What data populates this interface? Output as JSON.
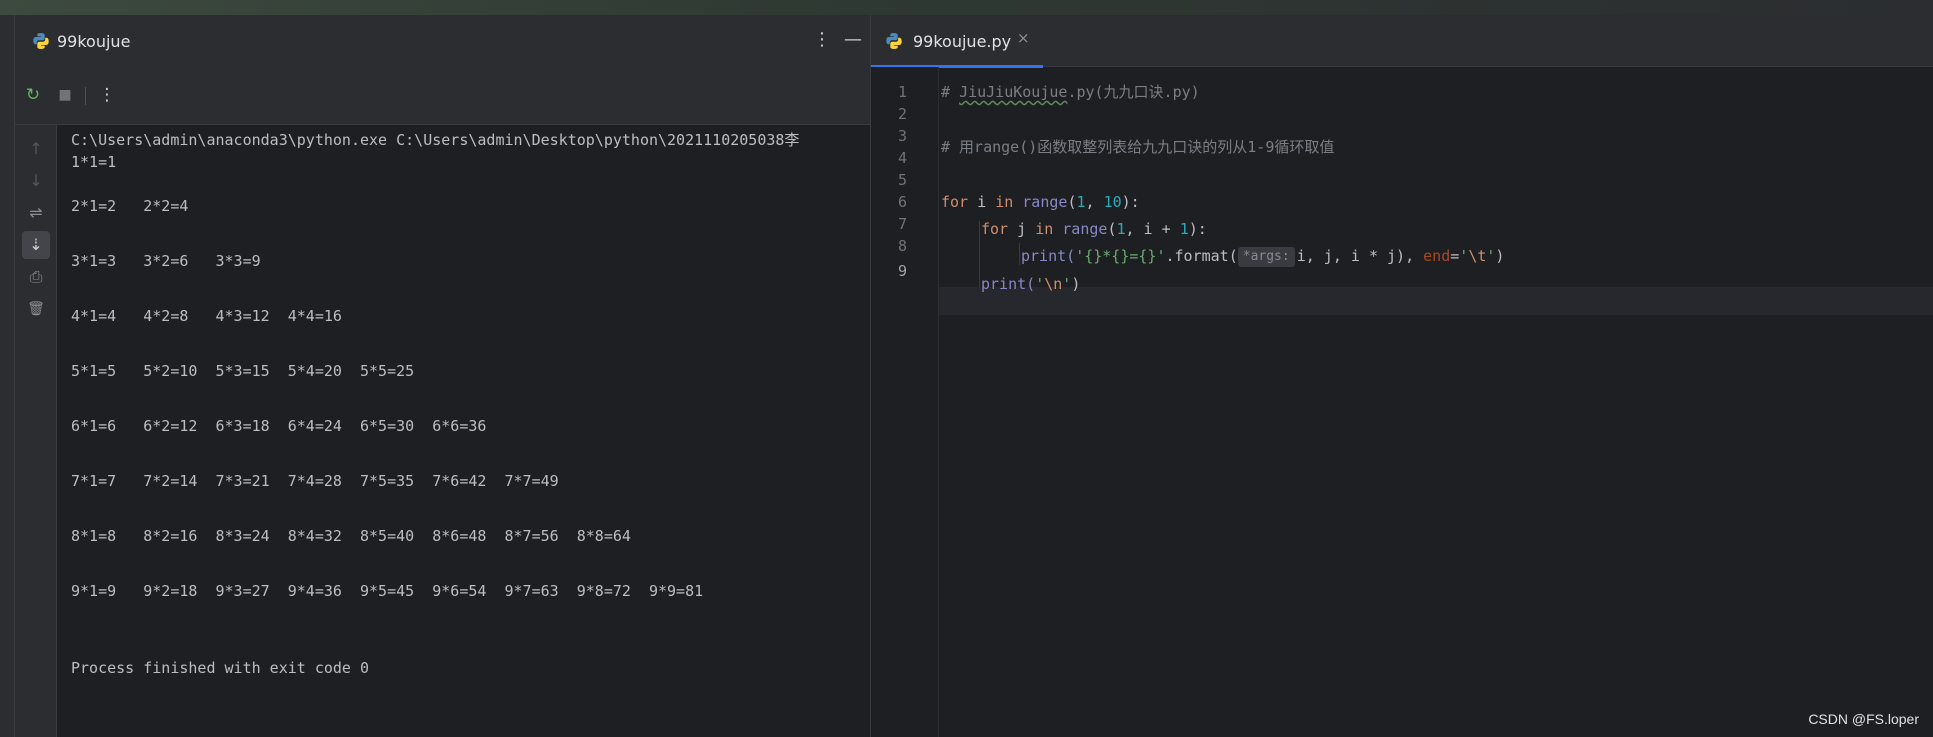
{
  "run_panel": {
    "title": "99koujue",
    "more_icon": "⋮",
    "minimize_icon": "—"
  },
  "toolbar": {
    "rerun_icon": "↻",
    "stop_icon": "■",
    "more_icon": "⋮"
  },
  "side_tools": {
    "up_icon": "↑",
    "down_icon": "↓",
    "wrap_icon": "⇌",
    "scroll_end_icon": "⇣",
    "print_icon": "⎙",
    "trash_icon": "🗑"
  },
  "console": {
    "lines": [
      "C:\\Users\\admin\\anaconda3\\python.exe C:\\Users\\admin\\Desktop\\python\\2021110205038李",
      "1*1=1",
      "",
      "2*1=2\t2*2=4",
      "",
      "3*1=3\t3*2=6\t3*3=9",
      "",
      "4*1=4\t4*2=8\t4*3=12\t4*4=16",
      "",
      "5*1=5\t5*2=10\t5*3=15\t5*4=20\t5*5=25",
      "",
      "6*1=6\t6*2=12\t6*3=18\t6*4=24\t6*5=30\t6*6=36",
      "",
      "7*1=7\t7*2=14\t7*3=21\t7*4=28\t7*5=35\t7*6=42\t7*7=49",
      "",
      "8*1=8\t8*2=16\t8*3=24\t8*4=32\t8*5=40\t8*6=48\t8*7=56\t8*8=64",
      "",
      "9*1=9\t9*2=18\t9*3=27\t9*4=36\t9*5=45\t9*6=54\t9*7=63\t9*8=72\t9*9=81",
      "",
      "",
      "Process finished with exit code 0"
    ]
  },
  "editor": {
    "tab_label": "99koujue.py",
    "tab_close": "×",
    "line_numbers": [
      "1",
      "2",
      "3",
      "4",
      "5",
      "6",
      "7",
      "8",
      "9"
    ],
    "current_line": "9",
    "code": {
      "l1_hash": "# ",
      "l1_squig": "JiuJiuKoujue",
      "l1_rest": ".py(九九口诀.py)",
      "l3": "# 用range()函数取整列表给九九口诀的列从1-9循环取值",
      "l5_for": "for",
      "l5_i": " i ",
      "l5_in": "in",
      "l5_sp": " ",
      "l5_range": "range",
      "l5_open": "(",
      "l5_n1": "1",
      "l5_comma": ", ",
      "l5_n2": "10",
      "l5_close": "):",
      "l6_for": "for",
      "l6_j": " j ",
      "l6_in": "in",
      "l6_sp": " ",
      "l6_range": "range",
      "l6_open": "(",
      "l6_n1": "1",
      "l6_mid": ", i + ",
      "l6_n2": "1",
      "l6_close": "):",
      "l7_print": "print(",
      "l7_str": "'{}*{}={}'",
      "l7_fmt": ".format(",
      "l7_hint": "*args:",
      "l7_args": "i, j, i * j), ",
      "l7_end": "end",
      "l7_eq": "=",
      "l7_q1": "'",
      "l7_esc": "\\t",
      "l7_q2": "'",
      "l7_close": ")",
      "l8_print": "print(",
      "l8_q1": "'",
      "l8_esc": "\\n",
      "l8_q2": "'",
      "l8_close": ")"
    }
  },
  "watermark": "CSDN @FS.loper",
  "colors": {
    "background": "#1e1f22",
    "panel": "#2b2d30",
    "accent": "#3574f0",
    "keyword": "#cf8e6d",
    "string": "#6aab73",
    "number": "#2aacb8"
  },
  "icons": {
    "file_icon": "python-file-icon"
  }
}
